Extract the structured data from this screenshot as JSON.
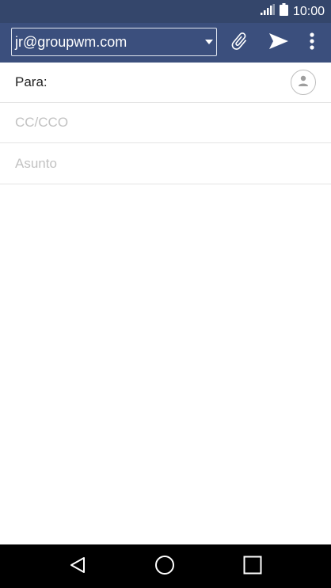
{
  "status_bar": {
    "time": "10:00",
    "icons": [
      "signal-icon",
      "battery-icon"
    ]
  },
  "compose_header": {
    "account": "jr@groupwm.com",
    "icons": [
      "chevron-down-icon",
      "paperclip-icon",
      "send-icon",
      "more-vert-icon"
    ]
  },
  "fields": {
    "to_label": "Para:",
    "cc_placeholder": "CC/CCO",
    "subject_placeholder": "Asunto"
  },
  "body": {
    "text": ""
  },
  "nav": {
    "icons": [
      "back-icon",
      "home-icon",
      "recents-icon"
    ]
  },
  "colors": {
    "status_bar": "#34466b",
    "app_bar": "#3b4f7d",
    "placeholder": "#c2c2c2",
    "divider": "#e4e4e4"
  }
}
